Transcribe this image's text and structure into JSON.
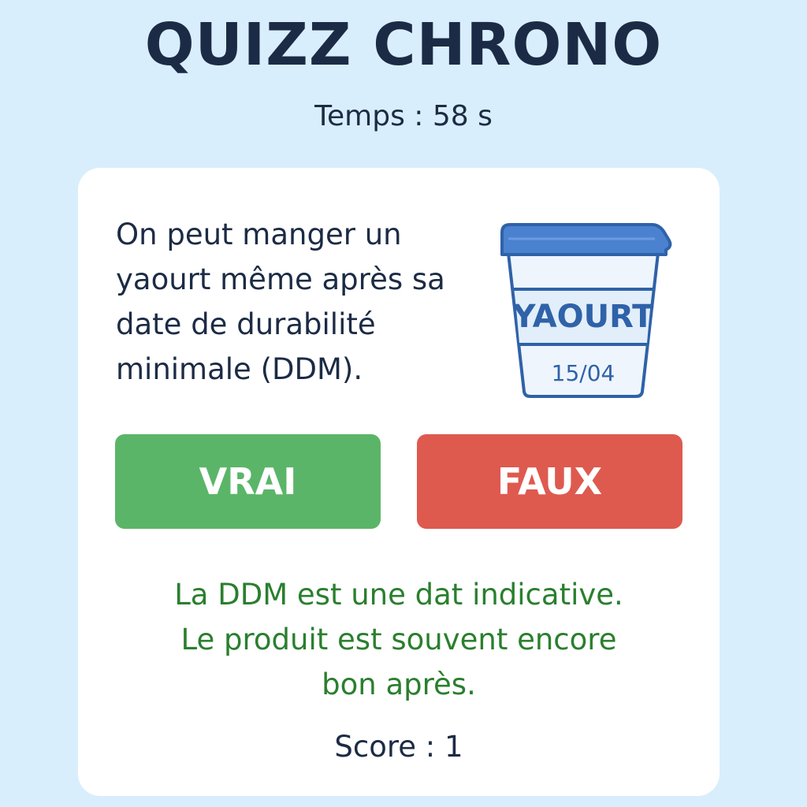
{
  "header": {
    "title": "QUIZZ CHRONO",
    "timer": "Temps : 58 s"
  },
  "question": {
    "text": "On peut manger un yaourt même après sa date de durabilité minimale (DDM).",
    "image": {
      "label": "YAOURT",
      "date": "15/04",
      "icon": "yogurt-pot-icon"
    }
  },
  "answers": {
    "true_label": "VRAI",
    "false_label": "FAUX"
  },
  "feedback": {
    "line1": "La DDM est une dat indicative.",
    "line2": "Le produit est souvent encore",
    "line3": "bon après."
  },
  "score": "Score : 1",
  "colors": {
    "background": "#d9eefc",
    "card": "#ffffff",
    "text": "#1c2b45",
    "true_button": "#5bb568",
    "false_button": "#de5a4f",
    "feedback": "#2a7f2e",
    "lid": "#4a82cf",
    "pot_outline": "#2f62a8"
  }
}
